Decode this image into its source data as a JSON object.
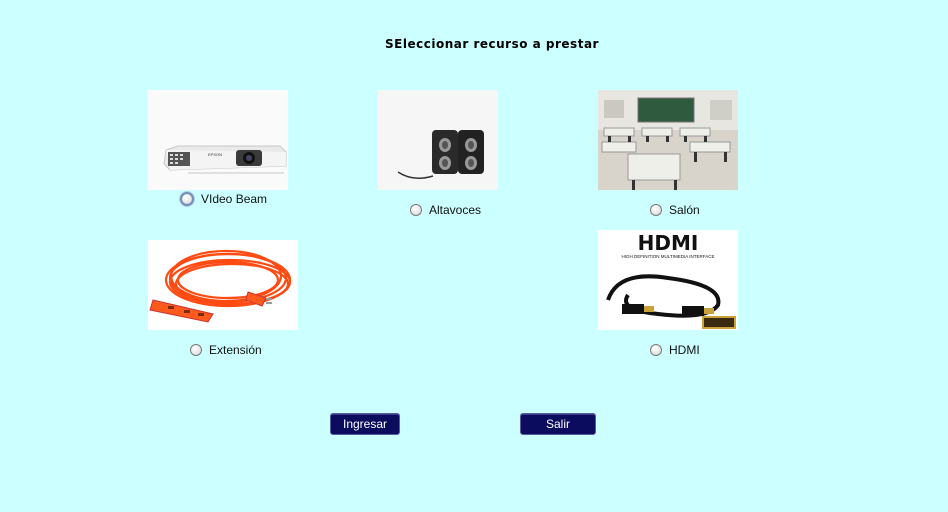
{
  "page": {
    "title": "SEleccionar recurso a prestar"
  },
  "resources": [
    {
      "label": "VIdeo Beam",
      "image": "projector-image",
      "selected": false
    },
    {
      "label": "Altavoces",
      "image": "speakers-image",
      "selected": false
    },
    {
      "label": "Salón",
      "image": "classroom-image",
      "selected": false
    },
    {
      "label": "Extensión",
      "image": "extension-cord-image",
      "selected": false
    },
    {
      "label": "HDMI",
      "image": "hdmi-cable-image",
      "selected": false
    }
  ],
  "hdmi_image": {
    "logo_text": "HDMI",
    "tagline": "HIGH DEFINITION MULTIMEDIA INTERFACE"
  },
  "projector_image": {
    "brand": "EPSON"
  },
  "buttons": {
    "submit_label": "Ingresar",
    "exit_label": "Salir"
  },
  "colors": {
    "background": "#ccffff",
    "button": "#0c0c5e"
  }
}
